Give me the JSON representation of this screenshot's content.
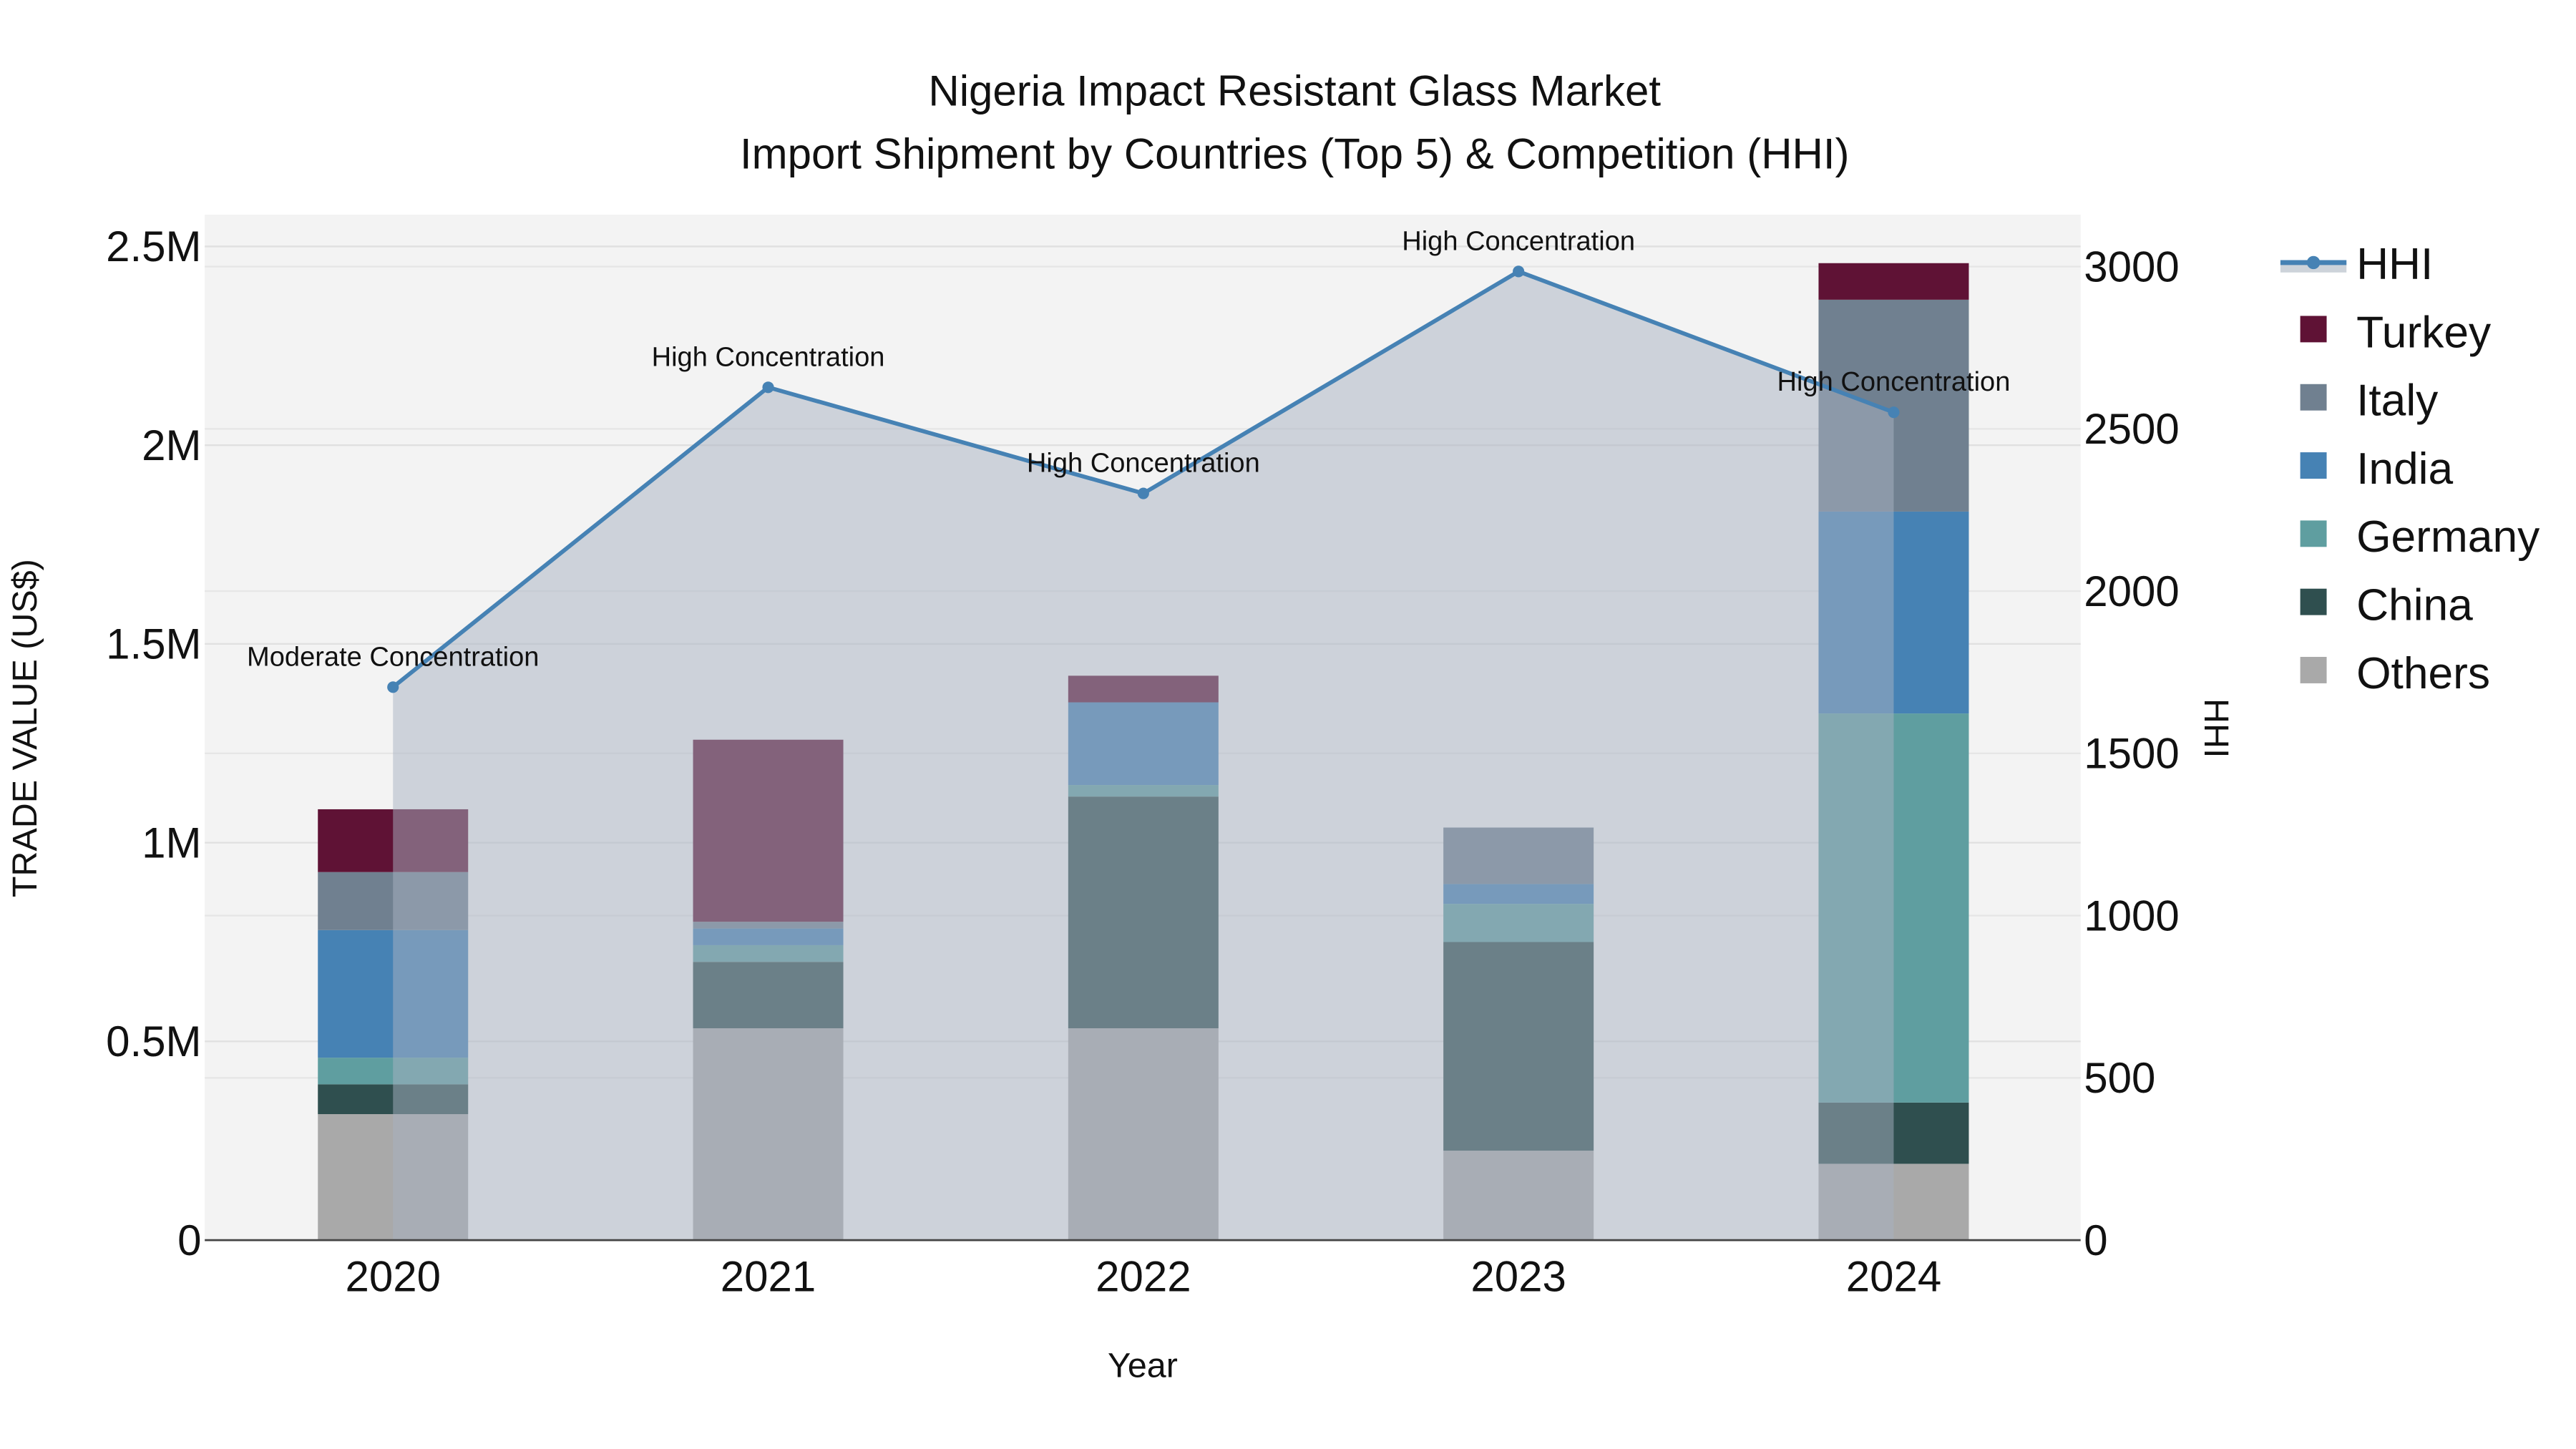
{
  "chart_data": {
    "type": "bar",
    "title": "Nigeria Impact Resistant Glass Market",
    "subtitle": "Import Shipment by Countries (Top 5) & Competition (HHI)",
    "xlabel": "Year",
    "ylabel": "TRADE VALUE (US$)",
    "y2label": "HHI",
    "categories": [
      "2020",
      "2021",
      "2022",
      "2023",
      "2024"
    ],
    "ylim": [
      0,
      2580000
    ],
    "y2lim": [
      0,
      3160
    ],
    "yticks": [
      {
        "v": 0,
        "label": "0"
      },
      {
        "v": 500000,
        "label": "0.5M"
      },
      {
        "v": 1000000,
        "label": "1M"
      },
      {
        "v": 1500000,
        "label": "1.5M"
      },
      {
        "v": 2000000,
        "label": "2M"
      },
      {
        "v": 2500000,
        "label": "2.5M"
      }
    ],
    "y2ticks": [
      {
        "v": 0,
        "label": "0"
      },
      {
        "v": 500,
        "label": "500"
      },
      {
        "v": 1000,
        "label": "1000"
      },
      {
        "v": 1500,
        "label": "1500"
      },
      {
        "v": 2000,
        "label": "2000"
      },
      {
        "v": 2500,
        "label": "2500"
      },
      {
        "v": 3000,
        "label": "3000"
      }
    ],
    "grid": true,
    "legend_position": "right",
    "series": [
      {
        "name": "Others",
        "color": "#a9a9a9",
        "values": [
          317000,
          533000,
          533000,
          225000,
          192000
        ]
      },
      {
        "name": "China",
        "color": "#2f4f4f",
        "values": [
          75000,
          167000,
          583000,
          525000,
          154000
        ]
      },
      {
        "name": "Germany",
        "color": "#5f9ea0",
        "values": [
          67000,
          42000,
          29000,
          96000,
          979000
        ]
      },
      {
        "name": "India",
        "color": "#4682b4",
        "values": [
          321000,
          42000,
          208000,
          50000,
          508000
        ]
      },
      {
        "name": "Italy",
        "color": "#708090",
        "values": [
          146000,
          17000,
          0,
          142000,
          533000
        ]
      },
      {
        "name": "Turkey",
        "color": "#5f1235",
        "values": [
          158000,
          458000,
          67000,
          0,
          92000
        ]
      }
    ],
    "hhi": {
      "name": "HHI",
      "color": "#4682b4",
      "values": [
        1704,
        2628,
        2301,
        2985,
        2551
      ],
      "annotations": [
        "Moderate Concentration",
        "High Concentration",
        "High Concentration",
        "High Concentration",
        "High Concentration"
      ]
    },
    "legend": [
      "HHI",
      "Turkey",
      "Italy",
      "India",
      "Germany",
      "China",
      "Others"
    ]
  }
}
